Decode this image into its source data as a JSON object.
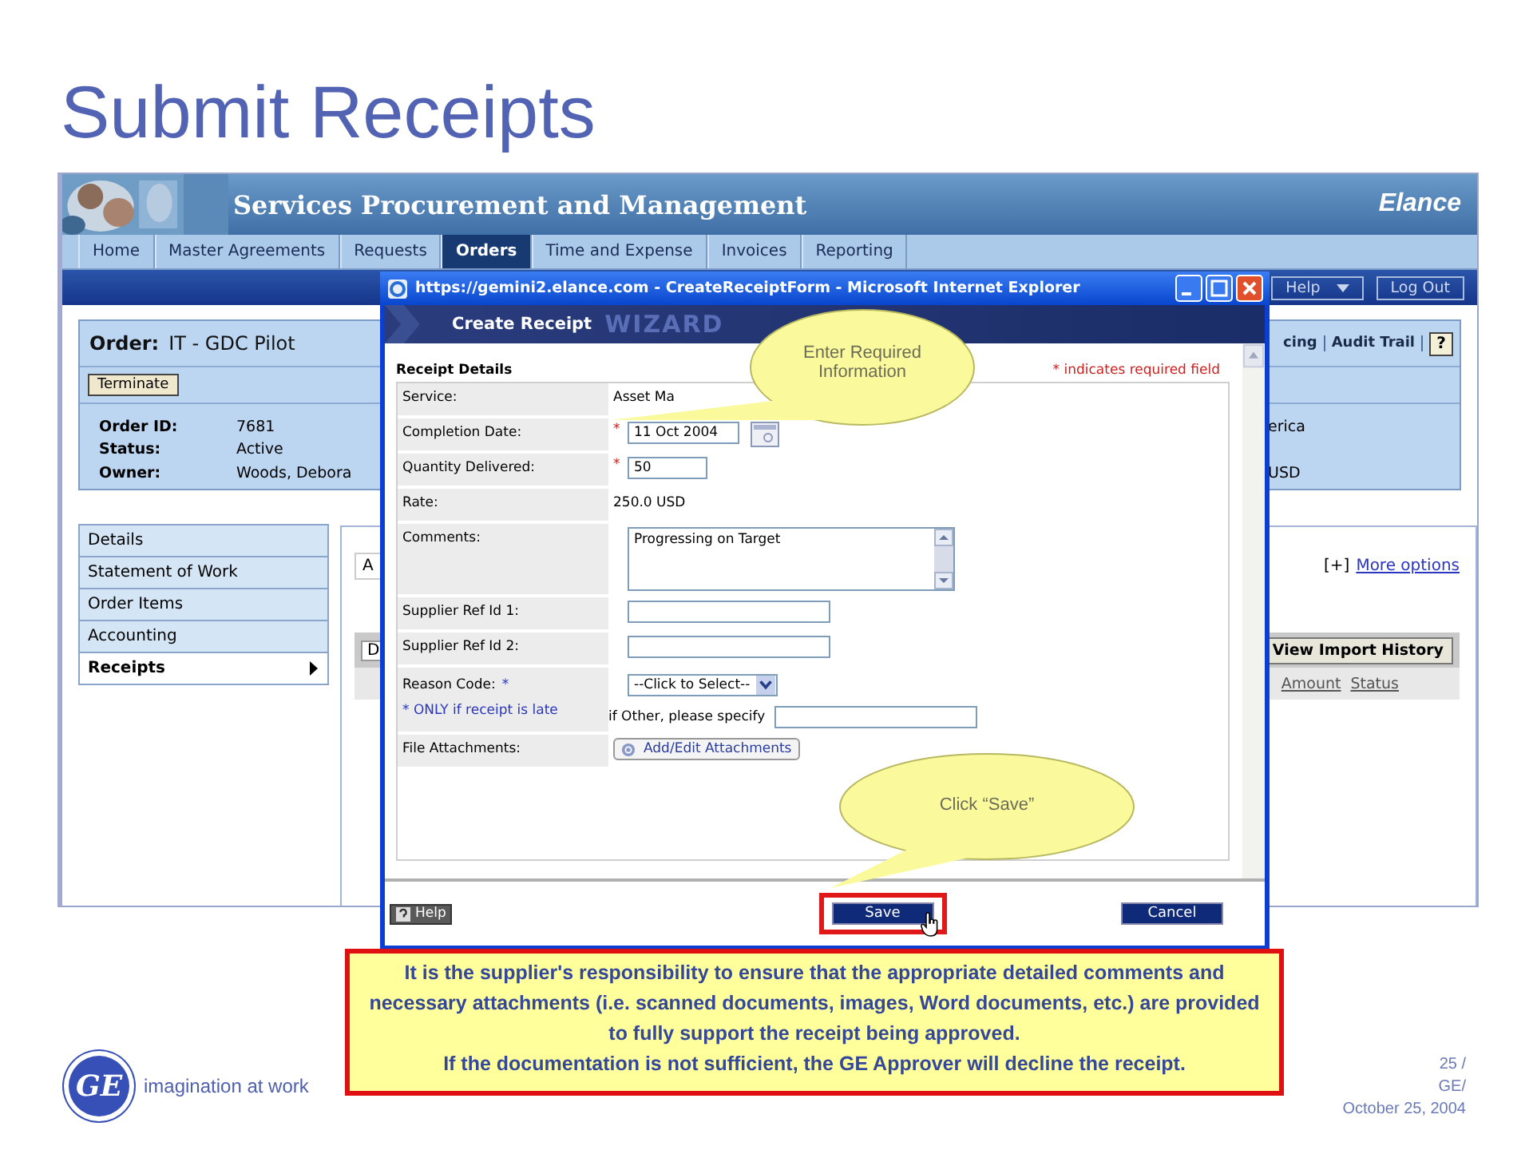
{
  "slide": {
    "title": "Submit Receipts"
  },
  "app": {
    "header_title": "Services Procurement and Management",
    "logo": "Elance",
    "tabs": [
      {
        "label": "Home",
        "selected": false
      },
      {
        "label": "Master Agreements",
        "selected": false
      },
      {
        "label": "Requests",
        "selected": false
      },
      {
        "label": "Orders",
        "selected": true
      },
      {
        "label": "Time and Expense",
        "selected": false
      },
      {
        "label": "Invoices",
        "selected": false
      },
      {
        "label": "Reporting",
        "selected": false
      }
    ],
    "top_buttons": [
      {
        "label": "Help",
        "dropdown": true
      },
      {
        "label": "Log Out",
        "dropdown": false
      }
    ],
    "order": {
      "label": "Order:",
      "name": "IT - GDC Pilot",
      "button": "Terminate",
      "links": [
        "cing",
        "Audit Trail"
      ],
      "help": "?",
      "fields": [
        {
          "label": "Order ID:",
          "value": "7681",
          "right": "erica"
        },
        {
          "label": "Status:",
          "value": "Active"
        },
        {
          "label": "Owner:",
          "value": "Woods, Debora",
          "right": "USD"
        }
      ]
    },
    "side_menu": [
      {
        "label": "Details",
        "selected": false
      },
      {
        "label": "Statement of Work",
        "selected": false
      },
      {
        "label": "Order Items",
        "selected": false
      },
      {
        "label": "Accounting",
        "selected": false
      },
      {
        "label": "Receipts",
        "selected": true
      }
    ],
    "content": {
      "field_fragment": "A",
      "more_prefix": "[+]",
      "more_link": "More options",
      "tab_fragment": "D",
      "button": "View Import History",
      "columns": [
        "Amount",
        "Status"
      ]
    }
  },
  "popup": {
    "title": "https://gemini2.elance.com - CreateReceiptForm - Microsoft Internet Explorer",
    "header": "Create Receipt",
    "watermark": "WIZARD",
    "section": "Receipt Details",
    "required_note": "* indicates required field",
    "rows": [
      {
        "kind": "text",
        "label": "Service:",
        "value": "Asset Ma"
      },
      {
        "kind": "date",
        "label": "Completion Date:",
        "required_mark": "*",
        "value": "11 Oct 2004"
      },
      {
        "kind": "input",
        "label": "Quantity Delivered:",
        "required_mark": "*",
        "value": "50"
      },
      {
        "kind": "text",
        "label": "Rate:",
        "value": "250.0 USD"
      },
      {
        "kind": "textarea",
        "label": "Comments:",
        "value": "Progressing on Target"
      },
      {
        "kind": "input",
        "label": "Supplier Ref Id 1:"
      },
      {
        "kind": "input",
        "label": "Supplier Ref Id 2:"
      },
      {
        "kind": "select",
        "label": "Reason Code:",
        "label_mark": "*",
        "note": "* ONLY if receipt is late",
        "value": "--Click to Select--",
        "other_label": "if Other, please specify"
      },
      {
        "kind": "attach",
        "label": "File Attachments:",
        "button": "Add/Edit Attachments"
      }
    ],
    "buttons": [
      {
        "kind": "help",
        "label": "Help",
        "highlighted": false
      },
      {
        "kind": "primary",
        "label": "Save",
        "highlighted": true
      },
      {
        "kind": "primary",
        "label": "Cancel",
        "highlighted": false
      }
    ]
  },
  "callouts": [
    {
      "text": "Enter Required Information"
    },
    {
      "text": "Click “Save”"
    }
  ],
  "note": {
    "paragraphs": [
      "It is the supplier's responsibility to ensure that the appropriate detailed comments and necessary attachments (i.e. scanned documents, images, Word documents, etc.) are provided to fully support the receipt being approved.",
      "If the documentation is not sufficient, the GE Approver will decline the receipt."
    ]
  },
  "footer": {
    "logo": "GE",
    "tagline": "imagination at work",
    "page": "25 /",
    "org": "GE/",
    "date": "October 25, 2004"
  }
}
